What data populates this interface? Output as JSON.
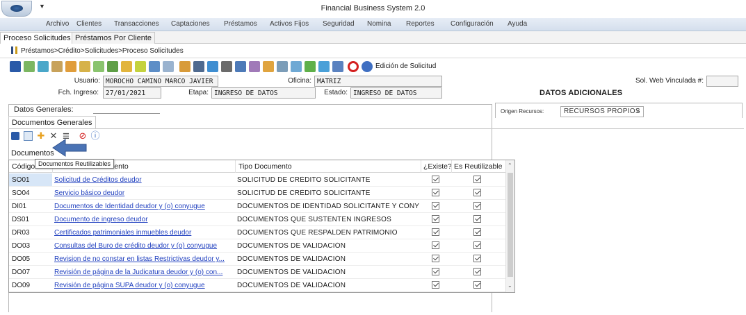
{
  "window": {
    "title": "Financial Business System 2.0"
  },
  "menu": [
    "Archivo",
    "Clientes",
    "Transacciones",
    "Captaciones",
    "Préstamos",
    "Activos Fijos",
    "Seguridad",
    "Nomina",
    "Reportes",
    "Configuración",
    "Ayuda"
  ],
  "doc_tabs": [
    "Proceso Solicitudes",
    "Préstamos Por Cliente"
  ],
  "breadcrumb": "Préstamos>Crédito>Solicitudes>Proceso Solicitudes",
  "toolbar": {
    "edit_label": "Edición de Solicitud",
    "icons": [
      "save-icon",
      "stop-icon",
      "refresh-icon",
      "users-icon",
      "chart-icon",
      "money-icon",
      "document-icon",
      "calendar-icon",
      "report-icon",
      "add-icon",
      "tree-icon",
      "grid-icon",
      "edit-icon",
      "list-icon",
      "export-icon",
      "import-icon",
      "book-icon",
      "people-icon",
      "spell-icon",
      "tools-icon",
      "link-icon",
      "template-icon",
      "globe-icon",
      "help-book-icon",
      "cancel-icon",
      "info-icon"
    ]
  },
  "header": {
    "usuario_label": "Usuario:",
    "usuario_value": "MOROCHO CAMINO MARCO JAVIER",
    "oficina_label": "Oficina:",
    "oficina_value": "MATRIZ",
    "sol_web_label": "Sol. Web Vinculada #:",
    "sol_web_value": "",
    "fch_label": "Fch. Ingreso:",
    "fch_value": "27/01/2021",
    "etapa_label": "Etapa:",
    "etapa_value": "INGRESO DE DATOS",
    "estado_label": "Estado:",
    "estado_value": "INGRESO DE DATOS",
    "datos_adicionales": "DATOS ADICIONALES"
  },
  "datos_generales": {
    "label": "Datos Generales:"
  },
  "origen": {
    "label": "Origen Recursos:",
    "value": "RECURSOS PROPIOS"
  },
  "subtab": "Documentos Generales",
  "documentos_label": "Documentos",
  "tooltip": "Documentos Reutilizables",
  "grid": {
    "headers": {
      "codigo": "Código",
      "documento": "Documento",
      "tipo": "Tipo Documento",
      "existe": "¿Existe?",
      "reutilizable": "Es Reutilizable"
    },
    "rows": [
      {
        "codigo": "SO01",
        "documento": "Solicitud de Créditos deudor",
        "tipo": "SOLICITUD DE CRÉDITO SOLICITANTE",
        "existe": true,
        "reutilizable": true
      },
      {
        "codigo": "SO04",
        "documento": "Servicio básico deudor",
        "tipo": "SOLICITUD DE CRÉDITO SOLICITANTE",
        "existe": true,
        "reutilizable": true
      },
      {
        "codigo": "DI01",
        "documento": "Documentos de Identidad deudor y (o) conyugue",
        "tipo": "DOCUMENTOS DE IDENTIDAD SOLICITANTE Y CONYU...",
        "existe": true,
        "reutilizable": true
      },
      {
        "codigo": "DS01",
        "documento": "Documento de ingreso deudor",
        "tipo": "DOCUMENTOS QUE SUSTENTEN INGRESOS",
        "existe": true,
        "reutilizable": true
      },
      {
        "codigo": "DR03",
        "documento": "Certificados patrimoniales inmuebles deudor",
        "tipo": "DOCUMENTOS QUE RESPALDEN PATRIMONIO",
        "existe": true,
        "reutilizable": true
      },
      {
        "codigo": "DO03",
        "documento": "Consultas del Buro de crédito deudor y (o) conyugue",
        "tipo": "DOCUMENTOS DE VALIDACIÓN",
        "existe": true,
        "reutilizable": true
      },
      {
        "codigo": "DO05",
        "documento": "Revision de no constar en listas Restrictivas deudor y...",
        "tipo": "DOCUMENTOS DE VALIDACIÓN",
        "existe": true,
        "reutilizable": true
      },
      {
        "codigo": "DO07",
        "documento": "Revisión de página de la Judicatura deudor y (o) con...",
        "tipo": "DOCUMENTOS DE VALIDACIÓN",
        "existe": true,
        "reutilizable": true
      },
      {
        "codigo": "DO09",
        "documento": "Revisión de página SUPA deudor y (o) conyugue",
        "tipo": "DOCUMENTOS DE VALIDACIÓN",
        "existe": true,
        "reutilizable": true
      }
    ]
  },
  "colors": {
    "menu_bg": "#dbe5f1",
    "link": "#1f3fbf",
    "selected_cell": "#d7e6f7",
    "arrow": "#4a73b5"
  }
}
